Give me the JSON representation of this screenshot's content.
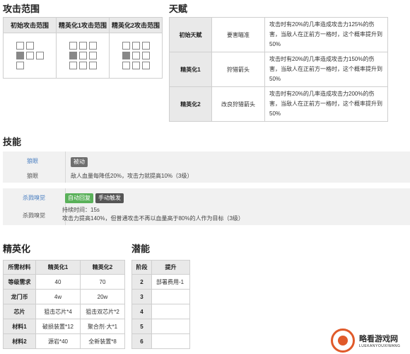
{
  "attack_range": {
    "title": "攻击范围",
    "columns": [
      "初始攻击范围",
      "精英化1攻击范围",
      "精英化2攻击范围"
    ],
    "grids": [
      [
        [
          "b",
          "b",
          ""
        ],
        [
          "f",
          "b",
          "b"
        ],
        [
          "b",
          "",
          ""
        ]
      ],
      [
        [
          "b",
          "b",
          "b"
        ],
        [
          "f",
          "b",
          "b"
        ],
        [
          "b",
          "b",
          "b"
        ]
      ],
      [
        [
          "b",
          "b",
          "b"
        ],
        [
          "f",
          "b",
          "b"
        ],
        [
          "b",
          "b",
          "b"
        ]
      ]
    ]
  },
  "talent": {
    "title": "天赋",
    "rows": [
      {
        "stage": "初始天赋",
        "name": "要害瞄准",
        "desc": "攻击时有20%的几率造成攻击力125%的伤害，当敌人在正前方一格时，这个概率提升到50%"
      },
      {
        "stage": "精英化1",
        "name": "狩猎箭头",
        "desc": "攻击时有20%的几率造成攻击力150%的伤害，当敌人在正前方一格时，这个概率提升到50%"
      },
      {
        "stage": "精英化2",
        "name": "改良狩猎箭头",
        "desc": "攻击时有20%的几率造成攻击力200%的伤害，当敌人在正前方一格时，这个概率提升到50%"
      }
    ]
  },
  "skills": {
    "title": "技能",
    "items": [
      {
        "link_name": "狼眼",
        "plain_name": "狼眼",
        "tags": [
          "被动"
        ],
        "desc": "敌人血量每降低20%，攻击力就提高10%（3级）"
      },
      {
        "link_name": "杀戮嗅觉",
        "plain_name": "杀戮嗅觉",
        "tags": [
          "自动回复",
          "手动触发"
        ],
        "duration": "持续时间：15s",
        "desc": "攻击力提高140%，但普通攻击不再以血量高于80%的人作为目标（3级）"
      }
    ]
  },
  "elite": {
    "title": "精英化",
    "headers": [
      "所需材料",
      "精英化1",
      "精英化2"
    ],
    "rows": [
      [
        "等级需求",
        "40",
        "70"
      ],
      [
        "龙门币",
        "4w",
        "20w"
      ],
      [
        "芯片",
        "狙击芯片*4",
        "狙击双芯片*2"
      ],
      [
        "材料1",
        "破损装置*12",
        "聚合剂·大*1"
      ],
      [
        "材料2",
        "源岩*40",
        "全新装置*8"
      ]
    ]
  },
  "potential": {
    "title": "潜能",
    "headers": [
      "阶段",
      "提升"
    ],
    "rows": [
      [
        "2",
        "部署费用-1"
      ],
      [
        "3",
        ""
      ],
      [
        "4",
        ""
      ],
      [
        "5",
        ""
      ],
      [
        "6",
        ""
      ]
    ]
  },
  "watermark": {
    "text": "略看游戏网",
    "sub": "LUEKANYOUXIWANG"
  }
}
